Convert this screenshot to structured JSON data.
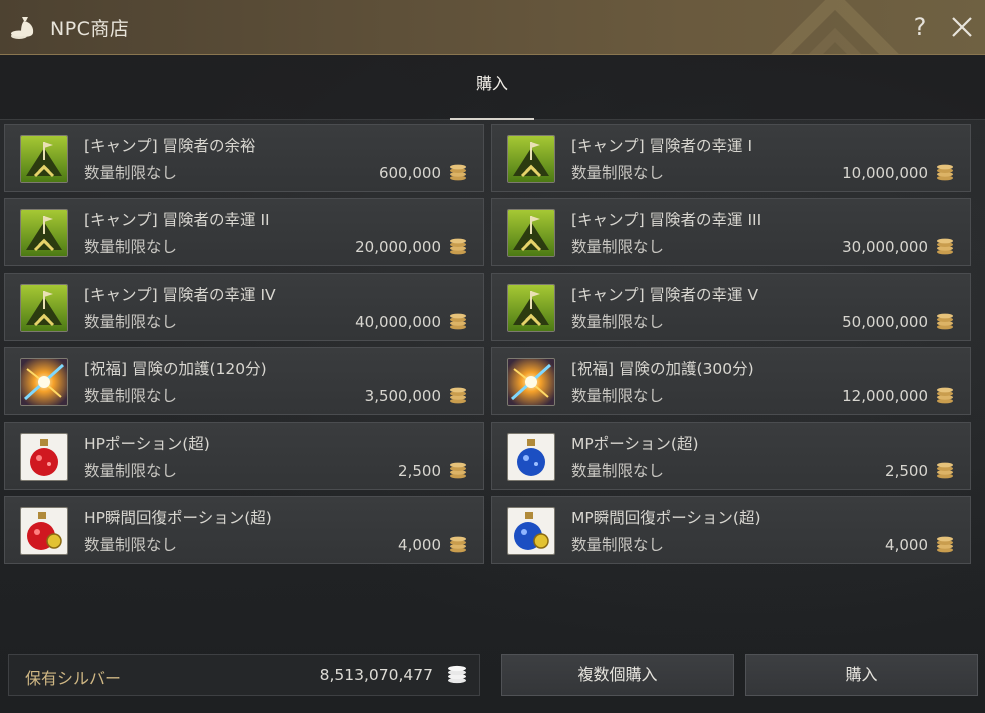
{
  "window": {
    "title": "NPC商店",
    "help_label": "?"
  },
  "tabs": [
    {
      "label": "購入",
      "active": true
    }
  ],
  "items": [
    {
      "name": "[キャンプ] 冒険者の余裕",
      "limit": "数量制限なし",
      "price": "600,000",
      "icon": "camp-tent-icon"
    },
    {
      "name": "[キャンプ] 冒険者の幸運 I",
      "limit": "数量制限なし",
      "price": "10,000,000",
      "icon": "camp-tent-icon"
    },
    {
      "name": "[キャンプ] 冒険者の幸運 II",
      "limit": "数量制限なし",
      "price": "20,000,000",
      "icon": "camp-tent-icon"
    },
    {
      "name": "[キャンプ] 冒険者の幸運 III",
      "limit": "数量制限なし",
      "price": "30,000,000",
      "icon": "camp-tent-icon"
    },
    {
      "name": "[キャンプ] 冒険者の幸運 IV",
      "limit": "数量制限なし",
      "price": "40,000,000",
      "icon": "camp-tent-icon"
    },
    {
      "name": "[キャンプ] 冒険者の幸運 V",
      "limit": "数量制限なし",
      "price": "50,000,000",
      "icon": "camp-tent-icon"
    },
    {
      "name": "[祝福] 冒険の加護(120分)",
      "limit": "数量制限なし",
      "price": "3,500,000",
      "icon": "blessing-sparkle-icon"
    },
    {
      "name": "[祝福] 冒険の加護(300分)",
      "limit": "数量制限なし",
      "price": "12,000,000",
      "icon": "blessing-sparkle-icon"
    },
    {
      "name": "HPポーション(超)",
      "limit": "数量制限なし",
      "price": "2,500",
      "icon": "hp-potion-icon"
    },
    {
      "name": "MPポーション(超)",
      "limit": "数量制限なし",
      "price": "2,500",
      "icon": "mp-potion-icon"
    },
    {
      "name": "HP瞬間回復ポーション(超)",
      "limit": "数量制限なし",
      "price": "4,000",
      "icon": "hp-instant-potion-icon"
    },
    {
      "name": "MP瞬間回復ポーション(超)",
      "limit": "数量制限なし",
      "price": "4,000",
      "icon": "mp-instant-potion-icon"
    }
  ],
  "footer": {
    "silver_label": "保有シルバー",
    "silver_value": "8,513,070,477",
    "bulk_buy_label": "複数個購入",
    "buy_label": "購入"
  },
  "colors": {
    "title_bar": "#5e5039",
    "accent_gold": "#cfb784",
    "item_bg": "#3a3c3e",
    "coin": "#d9b76a"
  }
}
